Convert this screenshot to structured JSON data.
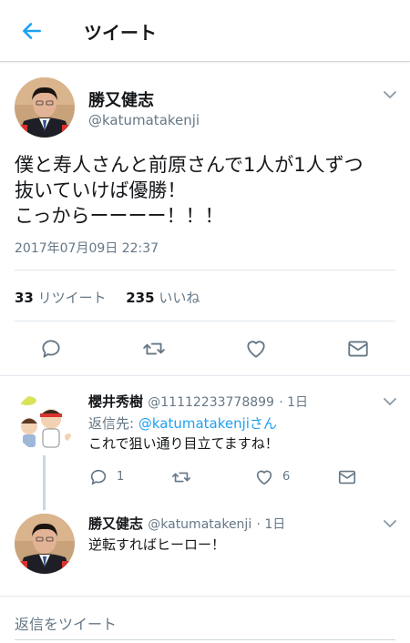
{
  "header": {
    "title": "ツイート"
  },
  "tweet": {
    "author_name": "勝又健志",
    "author_handle": "@katumatakenji",
    "text_lines": [
      "僕と寿人さんと前原さんで1人が1人ずつ",
      "抜いていけば優勝！",
      "こっからーーーー！！！"
    ],
    "timestamp": "2017年07月09日 22:37",
    "retweet_count": "33",
    "retweet_label": "リツイート",
    "like_count": "235",
    "like_label": "いいね"
  },
  "replies": [
    {
      "author_name": "櫻井秀樹",
      "author_handle": "@11112233778899",
      "time_ago": "· 1日",
      "reply_to_prefix": "返信先: ",
      "reply_to_mention": "@katumatakenjiさん",
      "text": "これで狙い通り目立てますね！",
      "reply_count": "1",
      "like_count": "6"
    },
    {
      "author_name": "勝又健志",
      "author_handle": "@katumatakenji",
      "time_ago": "· 1日",
      "text": "逆転すればヒーロー！"
    }
  ],
  "composer": {
    "placeholder": "返信をツイート"
  },
  "colors": {
    "accent": "#1da1f2",
    "text": "#14171a",
    "muted": "#657786",
    "divider": "#e1e8ed"
  }
}
